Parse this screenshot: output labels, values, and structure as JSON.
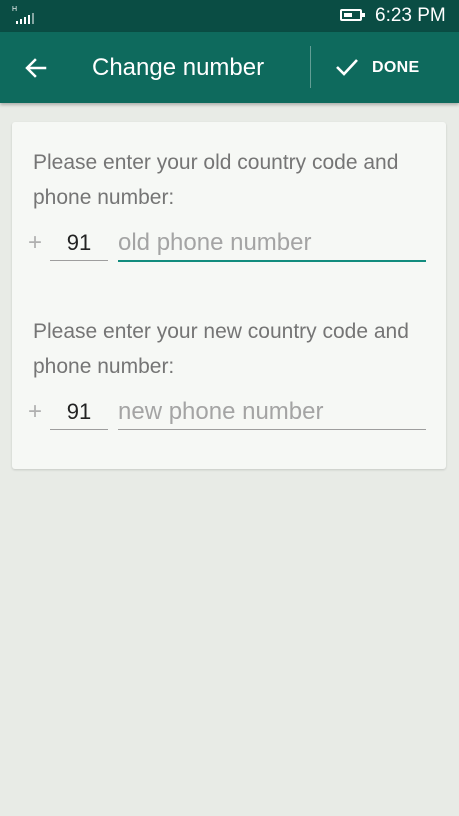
{
  "status_bar": {
    "network_label": "H",
    "battery_level_percent": 60,
    "time": "6:23 PM"
  },
  "app_bar": {
    "title": "Change number",
    "back_icon": "arrow-left-icon",
    "done_icon": "check-icon",
    "done_label": "DONE"
  },
  "form": {
    "old": {
      "prompt": "Please enter your old country code and phone number:",
      "plus": "+",
      "country_code": "91",
      "phone_placeholder": "old phone number",
      "phone_value": ""
    },
    "new": {
      "prompt": "Please enter your new country code and phone number:",
      "plus": "+",
      "country_code": "91",
      "phone_placeholder": "new phone number",
      "phone_value": ""
    }
  },
  "colors": {
    "status_bar": "#0a4d44",
    "app_bar": "#0e6a5d",
    "accent": "#128c7e",
    "background": "#e8ebe6"
  }
}
